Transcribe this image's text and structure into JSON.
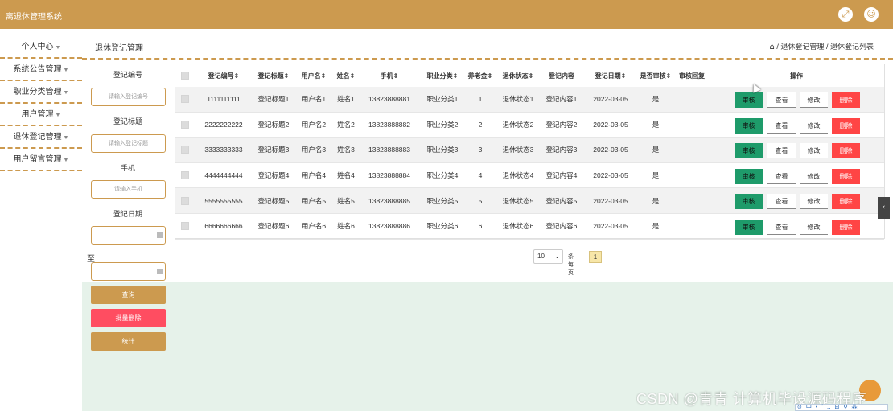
{
  "app": {
    "title": "离退休管理系统"
  },
  "header": {
    "fullscreen_icon": "fullscreen-icon",
    "avatar_icon": "user-avatar-icon"
  },
  "sidebar": {
    "items": [
      {
        "label": "个人中心"
      },
      {
        "label": "系统公告管理"
      },
      {
        "label": "职业分类管理"
      },
      {
        "label": "用户管理"
      },
      {
        "label": "退休登记管理"
      },
      {
        "label": "用户留言管理"
      }
    ]
  },
  "page": {
    "title": "退休登记管理",
    "breadcrumb": [
      "退休登记管理",
      "退休登记列表"
    ],
    "breadcrumb_sep": "/"
  },
  "search": {
    "code_label": "登记编号",
    "code_placeholder": "请输入登记编号",
    "title_label": "登记标题",
    "title_placeholder": "请输入登记标题",
    "phone_label": "手机",
    "phone_placeholder": "请输入手机",
    "date_label": "登记日期",
    "to_label": "至",
    "query_button": "查询",
    "batch_delete_button": "批量删除",
    "stats_button": "统计"
  },
  "table": {
    "columns": [
      "登记编号",
      "登记标题",
      "用户名",
      "姓名",
      "手机",
      "职业分类",
      "养老金",
      "退休状态",
      "登记内容",
      "登记日期",
      "是否审核",
      "审核回复",
      "操作"
    ],
    "rows": [
      [
        "1111111111",
        "登记标题1",
        "用户名1",
        "姓名1",
        "13823888881",
        "职业分类1",
        "1",
        "退休状态1",
        "登记内容1",
        "2022-03-05",
        "是",
        ""
      ],
      [
        "2222222222",
        "登记标题2",
        "用户名2",
        "姓名2",
        "13823888882",
        "职业分类2",
        "2",
        "退休状态2",
        "登记内容2",
        "2022-03-05",
        "是",
        ""
      ],
      [
        "3333333333",
        "登记标题3",
        "用户名3",
        "姓名3",
        "13823888883",
        "职业分类3",
        "3",
        "退休状态3",
        "登记内容3",
        "2022-03-05",
        "是",
        ""
      ],
      [
        "4444444444",
        "登记标题4",
        "用户名4",
        "姓名4",
        "13823888884",
        "职业分类4",
        "4",
        "退休状态4",
        "登记内容4",
        "2022-03-05",
        "是",
        ""
      ],
      [
        "5555555555",
        "登记标题5",
        "用户名5",
        "姓名5",
        "13823888885",
        "职业分类5",
        "5",
        "退休状态5",
        "登记内容5",
        "2022-03-05",
        "是",
        ""
      ],
      [
        "6666666666",
        "登记标题6",
        "用户名6",
        "姓名6",
        "13823888886",
        "职业分类6",
        "6",
        "退休状态6",
        "登记内容6",
        "2022-03-05",
        "是",
        ""
      ]
    ],
    "actions": {
      "audit": "审核",
      "view": "查看",
      "edit": "修改",
      "delete": "删除"
    }
  },
  "pagination": {
    "page_size": "10",
    "per_page_label": "条每页",
    "current_page": "1"
  },
  "watermark": "CSDN @青青  计算机毕设源码程序",
  "colors": {
    "brand": "#cc9a4f",
    "audit": "#1e9b6a",
    "danger": "#ff4545",
    "batch_delete": "#ff4d61"
  }
}
